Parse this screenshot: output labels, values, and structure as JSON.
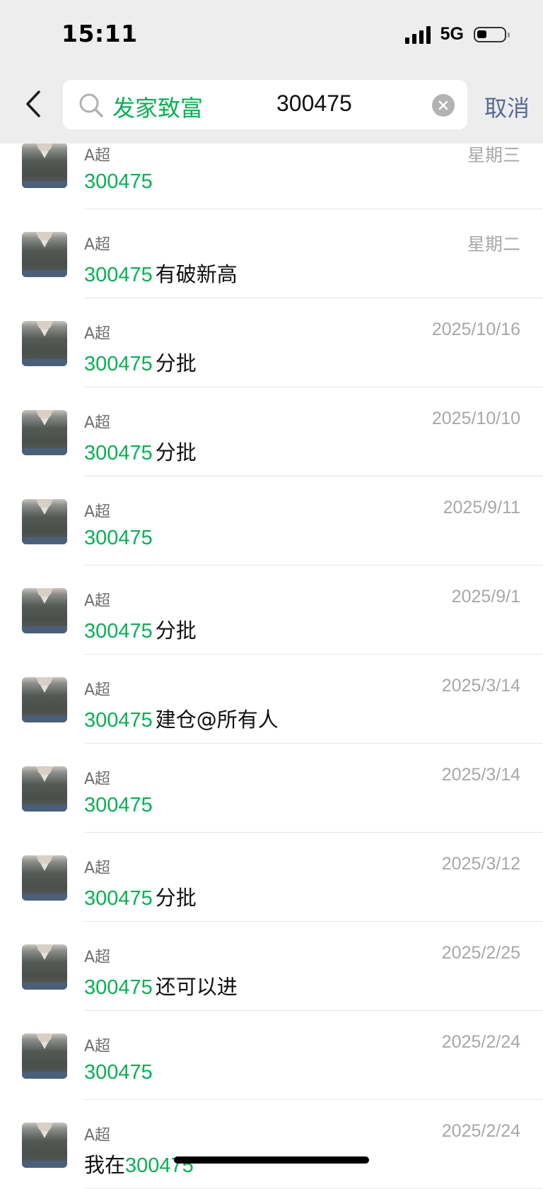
{
  "status_bar": {
    "time": "15:11",
    "network": "5G"
  },
  "search": {
    "keyword": "发家致富",
    "query": "300475",
    "cancel_label": "取消"
  },
  "colors": {
    "highlight": "#07b152",
    "cancel": "#576b95",
    "header_bg": "#ededed"
  },
  "results": [
    {
      "sender": "A超",
      "date": "星期三",
      "highlight": "300475",
      "rest": ""
    },
    {
      "sender": "A超",
      "date": "星期二",
      "highlight": "300475",
      "rest": "有破新高"
    },
    {
      "sender": "A超",
      "date": "2025/10/16",
      "highlight": "300475",
      "rest": "分批"
    },
    {
      "sender": "A超",
      "date": "2025/10/10",
      "highlight": "300475",
      "rest": "分批"
    },
    {
      "sender": "A超",
      "date": "2025/9/11",
      "highlight": "300475",
      "rest": ""
    },
    {
      "sender": "A超",
      "date": "2025/9/1",
      "highlight": "300475",
      "rest": "分批"
    },
    {
      "sender": "A超",
      "date": "2025/3/14",
      "highlight": "300475",
      "rest": "建仓@所有人"
    },
    {
      "sender": "A超",
      "date": "2025/3/14",
      "highlight": "300475",
      "rest": ""
    },
    {
      "sender": "A超",
      "date": "2025/3/12",
      "highlight": "300475",
      "rest": "分批"
    },
    {
      "sender": "A超",
      "date": "2025/2/25",
      "highlight": "300475",
      "rest": "还可以进"
    },
    {
      "sender": "A超",
      "date": "2025/2/24",
      "highlight": "300475",
      "rest": ""
    },
    {
      "sender": "A超",
      "date": "2025/2/24",
      "prefix": "我在",
      "highlight": "300475",
      "rest": ""
    }
  ]
}
